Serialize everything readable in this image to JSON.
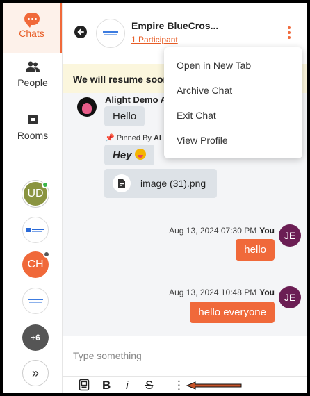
{
  "nav": {
    "chats_label": "Chats",
    "people_label": "People",
    "rooms_label": "Rooms"
  },
  "avatars": {
    "ud_initials": "UD",
    "ch_initials": "CH",
    "more_count": "+6",
    "expand_glyph": "»"
  },
  "header": {
    "title": "Empire BlueCros...",
    "participants": "1 Participant"
  },
  "banner": {
    "text": "We will resume soon"
  },
  "menu": {
    "items": [
      "Open in New Tab",
      "Archive Chat",
      "Exit Chat",
      "View Profile"
    ]
  },
  "messages": {
    "incoming": {
      "sender": "Alight Demo A",
      "hello": "Hello",
      "pinned_prefix": "Pinned By",
      "pinned_by": "Al",
      "hey": "Hey",
      "file_name": "image (31).png"
    },
    "outgoing": [
      {
        "time": "Aug 13, 2024 07:30 PM",
        "who": "You",
        "text": "hello",
        "initials": "JE"
      },
      {
        "time": "Aug 13, 2024 10:48 PM",
        "who": "You",
        "text": "hello everyone",
        "initials": "JE"
      }
    ]
  },
  "composer": {
    "placeholder": "Type something",
    "bold": "B",
    "italic": "i",
    "strike": "S",
    "more": "⋮"
  },
  "colors": {
    "accent": "#f0693a",
    "banner_bg": "#fbf6dd",
    "self_avatar": "#6b1e54",
    "arrow": "#c6542a"
  }
}
